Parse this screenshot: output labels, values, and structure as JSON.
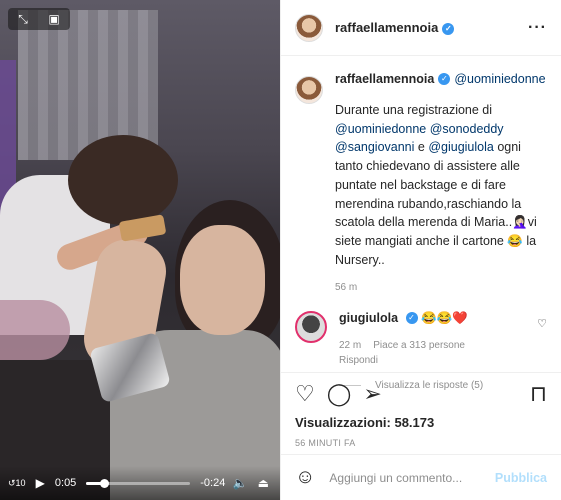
{
  "video": {
    "current_time": "0:05",
    "remaining_time": "-0:24",
    "progress": 0.17,
    "rewind_label": "10"
  },
  "post": {
    "username": "raffaellamennoia",
    "more_icon": "more-icon",
    "caption_mention": "@uominiedonne",
    "caption_text_1": "Durante una registrazione di",
    "caption_mention_line_1": "@uominiedonne @sonodeddy",
    "caption_mention_line_2a": "@sangiovanni",
    "caption_and": " e ",
    "caption_mention_line_2b": "@giugiulola",
    "caption_text_2": " ogni tanto chiedevano di assistere alle puntate nel backstage e di fare merendina rubando,raschiando la scatola della merenda di Maria..🤦🏻‍♀️vi siete mangiati anche il cartone 😂 la Nursery..",
    "caption_time": "56 m"
  },
  "reply": {
    "username": "giugiulola",
    "text": " 😂😂❤️",
    "time": "22 m",
    "likes": "Piace a 313 persone",
    "reply_label": "Rispondi",
    "view_replies": "Visualizza le risposte (5)"
  },
  "stats": {
    "views_label": "Visualizzazioni:",
    "views_count": "58.173",
    "posted": "56 MINUTI FA"
  },
  "comment_box": {
    "placeholder": "Aggiungi un commento...",
    "publish_label": "Pubblica"
  }
}
